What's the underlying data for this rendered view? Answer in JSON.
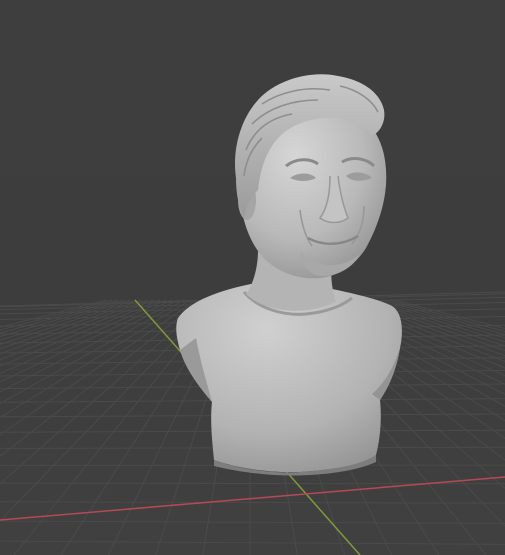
{
  "viewport": {
    "view_type": "3d-viewport",
    "background_color": "#3f3f3f",
    "grid_color": "#4a4a4a",
    "grid_floor_color": "#454545",
    "x_axis_color": "#b44a55",
    "y_axis_color": "#7e9a3a",
    "model_color": "#bdbdbd"
  },
  "scene": {
    "object_name": "bust-sculpt",
    "object_icon": "sculpted-bust"
  }
}
